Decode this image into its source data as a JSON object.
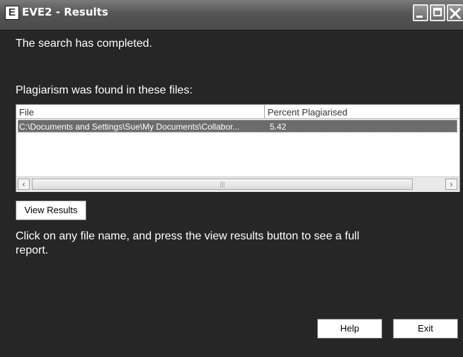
{
  "window": {
    "title": "EVE2 - Results",
    "app_icon": "E"
  },
  "messages": {
    "completed": "The search has completed.",
    "found_label": "Plagiarism was found in these files:",
    "instructions": "Click on any file name, and press the view results button to see a full report."
  },
  "results_table": {
    "columns": [
      "File",
      "Percent Plagiarised"
    ],
    "rows": [
      {
        "file": "C:\\Documents and Settings\\Sue\\My Documents\\Collabor...",
        "percent": "5.42",
        "selected": true
      }
    ]
  },
  "buttons": {
    "view_results": "View Results",
    "help": "Help",
    "exit": "Exit"
  },
  "icons": {
    "app": "eve-app-icon",
    "minimize": "minimize-icon",
    "maximize": "maximize-icon",
    "close": "close-icon",
    "scroll_left": "chevron-left-icon",
    "scroll_right": "chevron-right-icon"
  },
  "colors": {
    "background": "#262626",
    "selected_row": "#6c6c6c",
    "titlebar": "#555555"
  }
}
